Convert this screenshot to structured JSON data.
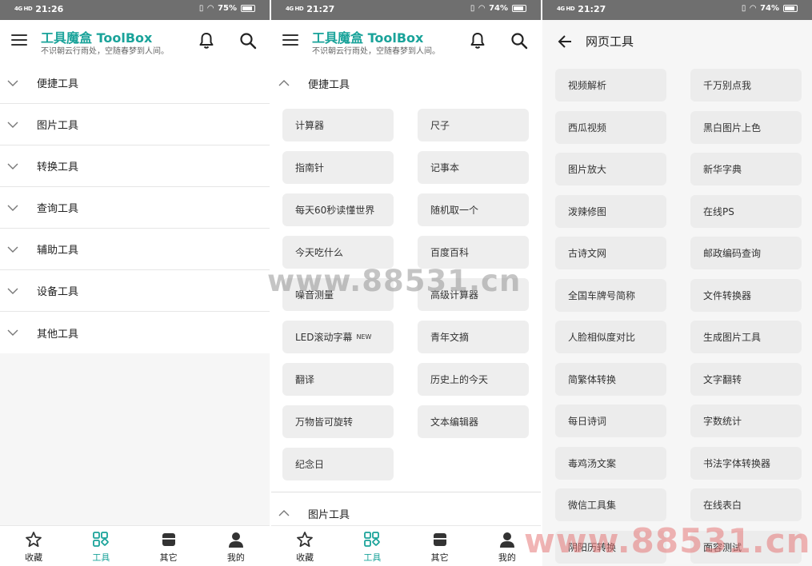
{
  "screens": [
    {
      "status": {
        "time": "21:26",
        "network": "4G HD",
        "battery": "75%"
      },
      "app_title": "工具魔盒 ToolBox",
      "app_subtitle": "不识朝云行雨处，空随春梦到人间。",
      "categories": [
        "便捷工具",
        "图片工具",
        "转换工具",
        "查询工具",
        "辅助工具",
        "设备工具",
        "其他工具"
      ]
    },
    {
      "status": {
        "time": "21:27",
        "network": "4G HD",
        "battery": "74%"
      },
      "app_title": "工具魔盒 ToolBox",
      "app_subtitle": "不识朝云行雨处，空随春梦到人间。",
      "expanded_section": "便捷工具",
      "tools": [
        "计算器",
        "尺子",
        "指南针",
        "记事本",
        "每天60秒读懂世界",
        "随机取一个",
        "今天吃什么",
        "百度百科",
        "噪音测量",
        "高级计算器",
        "LED滚动字幕",
        "青年文摘",
        "翻译",
        "历史上的今天",
        "万物皆可旋转",
        "文本编辑器",
        "纪念日"
      ],
      "new_badge": "NEW",
      "next_section": "图片工具"
    },
    {
      "status": {
        "time": "21:27",
        "network": "4G HD",
        "battery": "74%"
      },
      "page_title": "网页工具",
      "tools": [
        "视频解析",
        "千万别点我",
        "西瓜视频",
        "黑白图片上色",
        "图片放大",
        "新华字典",
        "泼辣修图",
        "在线PS",
        "古诗文网",
        "邮政编码查询",
        "全国车牌号简称",
        "文件转换器",
        "人脸相似度对比",
        "生成图片工具",
        "简繁体转换",
        "文字翻转",
        "每日诗词",
        "字数统计",
        "毒鸡汤文案",
        "书法字体转换器",
        "微信工具集",
        "在线表白",
        "阴阳历转换",
        "面容测试"
      ]
    }
  ],
  "bottom_nav": [
    "收藏",
    "工具",
    "其它",
    "我的"
  ],
  "active_nav": "工具",
  "watermarks": [
    "www.88531.cn",
    "www.88531.cn"
  ],
  "colors": {
    "accent": "#1aa39a",
    "statusbar": "#6f6f6f",
    "button_bg": "#eeeeee"
  }
}
